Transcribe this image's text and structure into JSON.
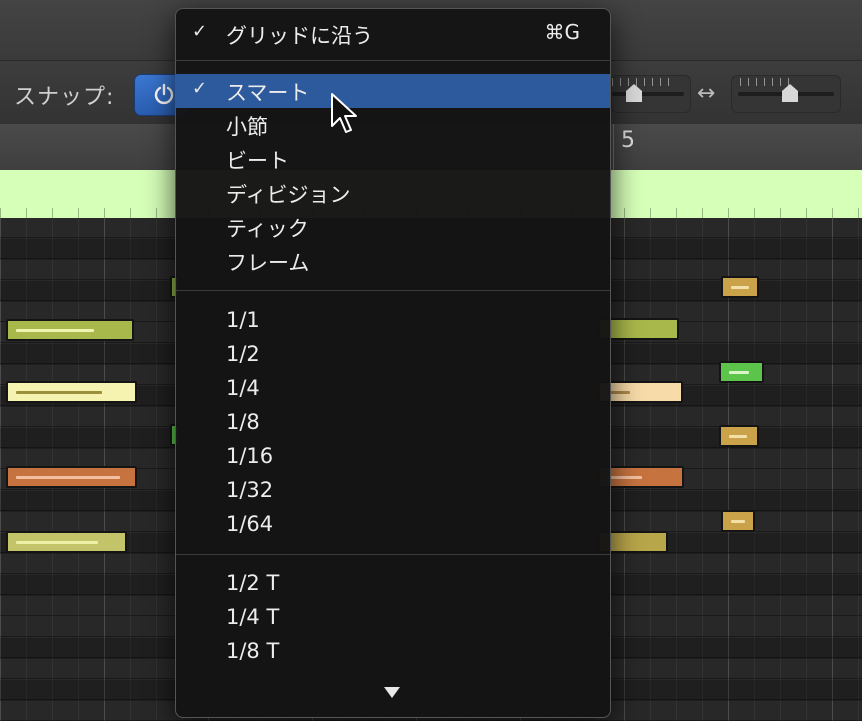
{
  "toolbar": {
    "snap_label": "スナップ:",
    "snap_icon": "power-icon",
    "hzoom_icon": "↔"
  },
  "ruler": {
    "bar_number": "5"
  },
  "menu": {
    "groups": [
      {
        "items": [
          {
            "label": "グリッドに沿う",
            "checked": true,
            "shortcut": "⌘G"
          }
        ]
      },
      {
        "items": [
          {
            "label": "スマート",
            "checked": true,
            "highlighted": true
          },
          {
            "label": "小節"
          },
          {
            "label": "ビート"
          },
          {
            "label": "ディビジョン"
          },
          {
            "label": "ティック"
          },
          {
            "label": "フレーム"
          }
        ]
      },
      {
        "items": [
          {
            "label": "1/1"
          },
          {
            "label": "1/2"
          },
          {
            "label": "1/4"
          },
          {
            "label": "1/8"
          },
          {
            "label": "1/16"
          },
          {
            "label": "1/32"
          },
          {
            "label": "1/64"
          }
        ]
      },
      {
        "items": [
          {
            "label": "1/2 T"
          },
          {
            "label": "1/4 T"
          },
          {
            "label": "1/8 T"
          }
        ]
      }
    ],
    "check_glyph": "✓",
    "more_icon": "scroll-down-arrow-icon"
  },
  "colors": {
    "highlight": "#2d5a9c",
    "region": "#d6ffb8",
    "note_olive": "#a9b84a",
    "note_cream": "#f6f2b0",
    "note_orange": "#c7733f",
    "note_gold": "#c9a24a",
    "note_green": "#5cc44a"
  }
}
